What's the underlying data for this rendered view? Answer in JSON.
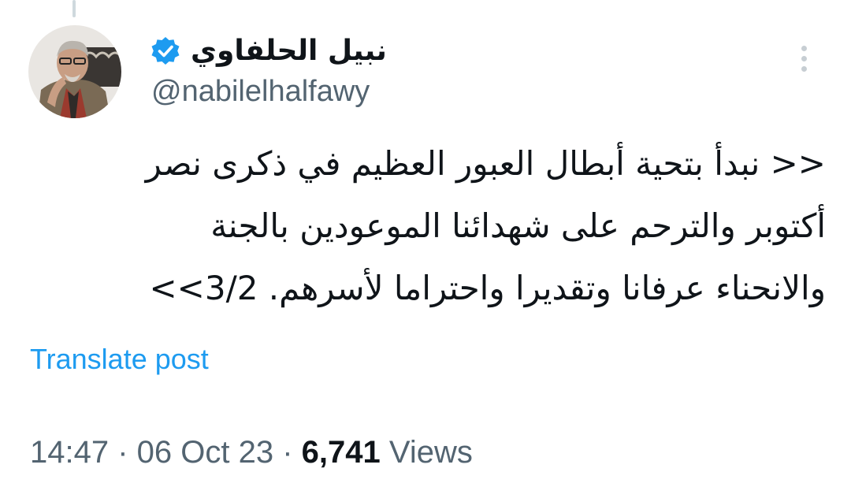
{
  "author": {
    "display_name": "نبيل الحلفاوي",
    "handle": "@nabilelhalfawy",
    "verified": true,
    "verified_color": "#1d9bf0"
  },
  "tweet": {
    "lines": [
      "<< نبدأ بتحية أبطال العبور العظيم في ذكرى نصر",
      "أكتوبر والترحم على شهدائنا الموعودين بالجنة",
      "والانحناء عرفانا وتقديرا واحتراما لأسرهم. 3/2>>"
    ]
  },
  "actions": {
    "translate_label": "Translate post",
    "more_icon": "more-vertical-icon"
  },
  "meta": {
    "time": "14:47",
    "separator": " · ",
    "date": "06 Oct 23",
    "views_count": "6,741",
    "views_label": " Views"
  },
  "colors": {
    "text": "#0f1419",
    "secondary": "#536471",
    "link": "#1d9bf0"
  }
}
